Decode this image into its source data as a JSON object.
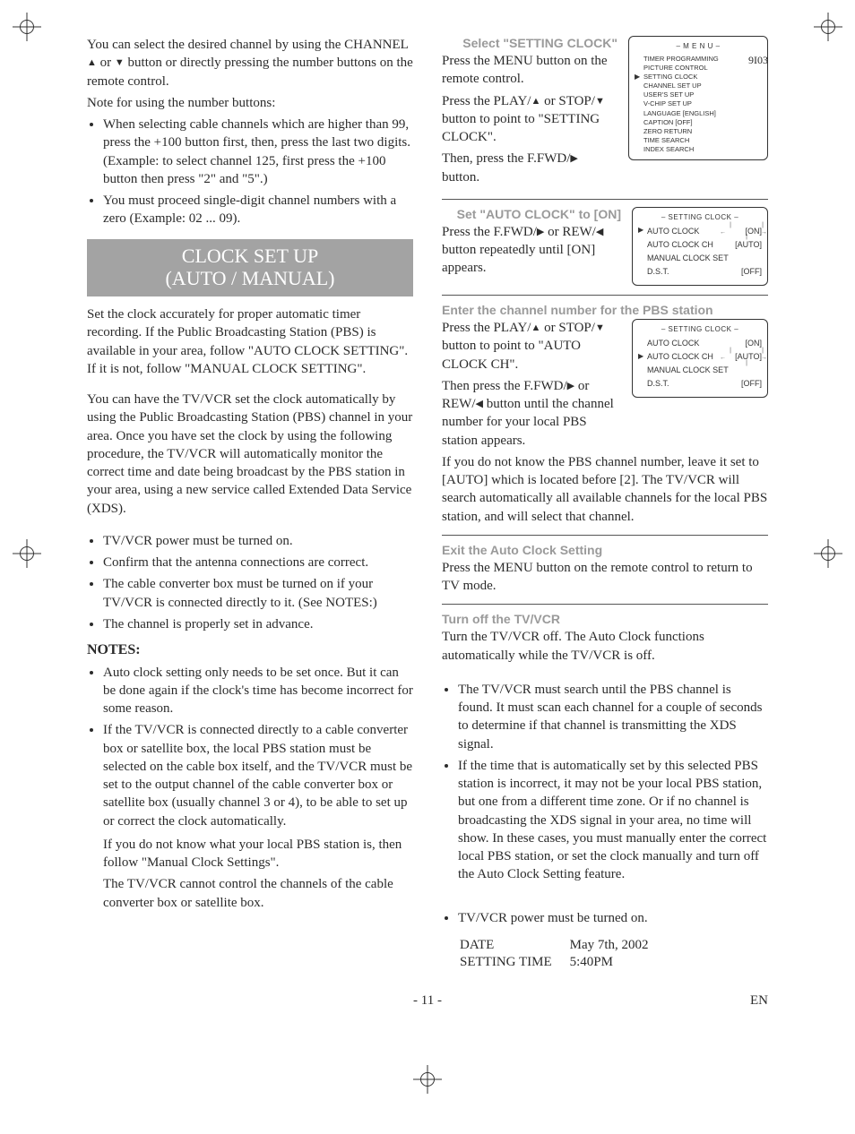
{
  "glyph": {
    "up": "▲",
    "down": "▼",
    "right": "▶",
    "left": "◀"
  },
  "left": {
    "channel_p1": "You can select the desired channel by using the CHANNEL {up} or {down} button or directly pressing the number buttons on the remote control.",
    "channel_note_intro": "Note for using the number buttons:",
    "channel_bullets": [
      "When selecting cable channels which are higher than 99, press the +100 button first, then, press the last two digits. (Example: to select channel 125, first press the +100 button then press \"2\" and \"5\".)",
      "You must proceed single-digit channel numbers with a zero (Example: 02 ...  09)."
    ],
    "section_title_line1": "CLOCK SET UP",
    "section_title_line2": "(AUTO / MANUAL)",
    "clock_intro": "Set the clock accurately for proper automatic timer recording. If the Public Broadcasting Station (PBS) is available in your area, follow \"AUTO CLOCK SETTING\". If it is not, follow \"MANUAL CLOCK SETTING\".",
    "auto_intro": "You can have the TV/VCR set the clock automatically by using the Public Broadcasting Station (PBS) channel in your area. Once you have set the clock by using the following procedure, the TV/VCR will automatically monitor the correct time and date being broadcast by the PBS station in your area, using a new service called Extended Data Service (XDS).",
    "pre_bullets": [
      "TV/VCR power must be turned on.",
      "Confirm that the antenna connections are correct.",
      "The cable converter box must be turned on if your TV/VCR is connected directly to it. (See NOTES:)",
      "The channel is properly set in advance."
    ],
    "notes_label": "NOTES:",
    "notes_bullets": [
      "Auto clock setting only needs to be set once. But it can be done again if the clock's time has become incorrect for some reason.",
      "If the TV/VCR is connected directly to a cable converter box or satellite box, the local PBS station must be selected on the cable box itself, and the TV/VCR must be set to the output channel of the cable converter box or satellite box (usually channel 3 or 4), to be able to set up or correct the clock automatically."
    ],
    "notes_tail1": "If you do not know what your local PBS station is, then follow \"Manual Clock Settings\".",
    "notes_tail2": "The TV/VCR cannot control the channels of the cable converter box or satellite box."
  },
  "right": {
    "step1": {
      "title": "Select \"SETTING CLOCK\"",
      "p1": "Press the MENU button on the remote control.",
      "p2": "Press the PLAY/{up} or STOP/{down} button to point to \"SETTING CLOCK\".",
      "p3": "Then, press the F.FWD/{right} button."
    },
    "step2": {
      "title": "Set \"AUTO CLOCK\" to [ON]",
      "p1": "Press the F.FWD/{right} or REW/{left} button repeatedly until [ON] appears."
    },
    "step3": {
      "title": "Enter the channel number for the PBS station",
      "p1": "Press the PLAY/{up} or STOP/{down} button to point to \"AUTO CLOCK CH\".",
      "p2": "Then press the F.FWD/{right} or REW/{left} button until the channel number for your local PBS station appears.",
      "tail": "If you do not know the PBS channel number, leave it set to [AUTO] which is located before [2]. The TV/VCR will search automatically all available channels for the local PBS station, and will select that channel."
    },
    "step4": {
      "title": "Exit the Auto Clock Setting",
      "p1": "Press the MENU button on the remote control to return to TV mode."
    },
    "step5": {
      "title": "Turn off the TV/VCR",
      "p1": "Turn the TV/VCR off. The Auto Clock functions automatically while the TV/VCR is off."
    },
    "end_bullets": [
      "The TV/VCR must search until the PBS channel is found. It must scan each channel for a couple of seconds to determine if that channel is transmitting the XDS signal.",
      "If the time that is automatically set by this selected PBS station is incorrect, it may not be your local PBS station, but one from a different time zone. Or if no channel is broadcasting the XDS signal in your area, no time will show. In these cases, you must manually enter the correct local PBS station, or set the clock manually and turn off the Auto Clock Setting feature."
    ],
    "pre_bullet": "TV/VCR power must be turned on.",
    "example": {
      "date_label": "DATE",
      "date_value": "May 7th, 2002",
      "time_label": "SETTING TIME",
      "time_value": "5:40PM"
    }
  },
  "osd": {
    "menu_title": "– M E N U –",
    "menu_items": [
      "TIMER PROGRAMMING",
      "PICTURE CONTROL",
      "SETTING CLOCK",
      "CHANNEL SET UP",
      "USER'S SET UP",
      "V-CHIP SET UP",
      "LANGUAGE    [ENGLISH]",
      "CAPTION  [OFF]",
      "ZERO RETURN",
      "TIME SEARCH",
      "INDEX SEARCH"
    ],
    "menu_pointer_index": 2,
    "clock_title": "– SETTING CLOCK –",
    "clock_step2": {
      "rows": [
        {
          "label": "AUTO CLOCK",
          "value": "[ON]",
          "pointer": true,
          "mark": true
        },
        {
          "label": "AUTO CLOCK CH",
          "value": "[AUTO]"
        },
        {
          "label": "MANUAL CLOCK SET",
          "value": ""
        },
        {
          "label": "D.S.T.",
          "value": "[OFF]"
        }
      ]
    },
    "clock_step3": {
      "rows": [
        {
          "label": "AUTO CLOCK",
          "value": "[ON]"
        },
        {
          "label": "AUTO CLOCK CH",
          "value": "[AUTO]",
          "pointer": true,
          "mark": true
        },
        {
          "label": "MANUAL CLOCK SET",
          "value": ""
        },
        {
          "label": "D.S.T.",
          "value": "[OFF]"
        }
      ]
    }
  },
  "footer": {
    "page": "- 11 -",
    "lang": "EN",
    "code": "9I03"
  }
}
